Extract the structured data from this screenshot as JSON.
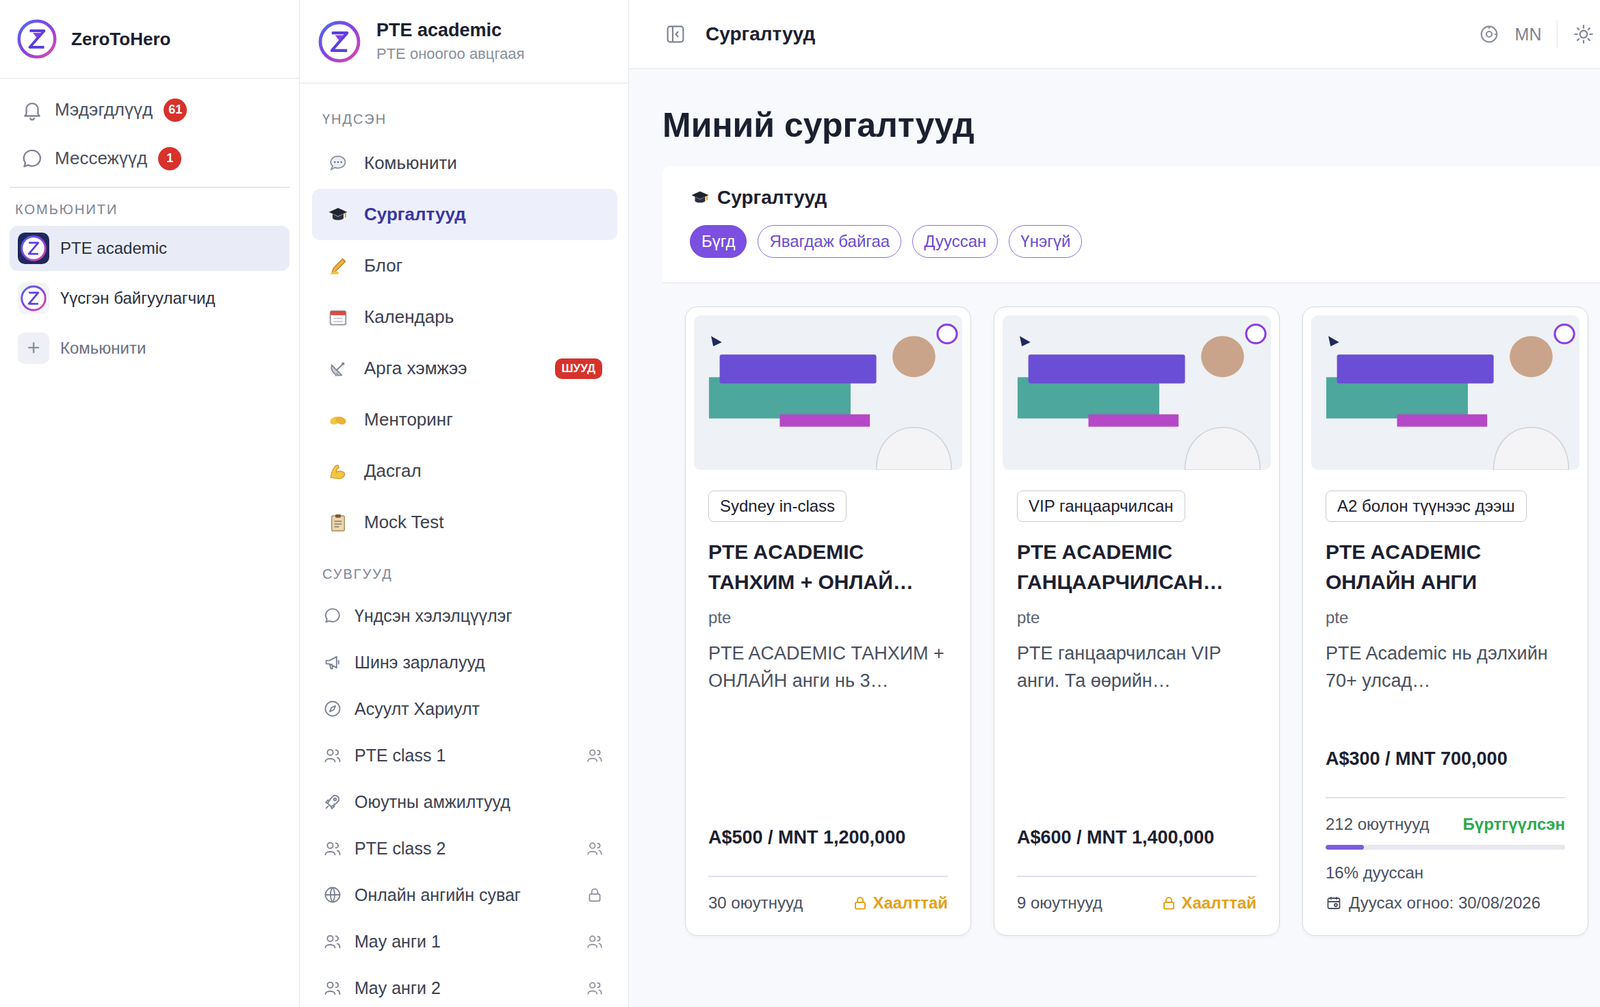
{
  "app": {
    "name": "ZeroToHero"
  },
  "nav": [
    {
      "label": "Мэдэгдлүүд",
      "badge": "61",
      "kind": "notifications"
    },
    {
      "label": "Мессежүүд",
      "badge": "1",
      "kind": "messages"
    }
  ],
  "communities": {
    "heading": "КОМЬЮНИТИ",
    "items": [
      {
        "label": "PTE academic",
        "selected": true
      },
      {
        "label": "Үүсгэн байгуулагчид",
        "selected": false
      }
    ],
    "add": {
      "icon": "+",
      "label": "Комьюнити"
    }
  },
  "community": {
    "name": "PTE academic",
    "subtitle": "PTE оноогоо авцгаая"
  },
  "menu": {
    "heading": "ҮНДСЭН",
    "items": [
      {
        "kind": "community",
        "label": "Комьюнити",
        "selected": false,
        "badge": ""
      },
      {
        "kind": "courses",
        "label": "Сургалтууд",
        "selected": true,
        "badge": ""
      },
      {
        "kind": "blog",
        "label": "Блог",
        "selected": false,
        "badge": ""
      },
      {
        "kind": "calendar",
        "label": "Календарь",
        "selected": false,
        "badge": ""
      },
      {
        "kind": "events",
        "label": "Арга хэмжээ",
        "selected": false,
        "badge": "ШУУД"
      },
      {
        "kind": "mentoring",
        "label": "Менторинг",
        "selected": false,
        "badge": ""
      },
      {
        "kind": "exercise",
        "label": "Дасгал",
        "selected": false,
        "badge": ""
      },
      {
        "kind": "mock-test",
        "label": "Mock Test",
        "selected": false,
        "badge": ""
      }
    ]
  },
  "channels": {
    "heading": "СУВГУУД",
    "items": [
      {
        "kind": "discussion",
        "label": "Үндсэн хэлэлцүүлэг",
        "locked": false
      },
      {
        "kind": "announcement",
        "label": "Шинэ зарлалууд",
        "locked": false
      },
      {
        "kind": "qa",
        "label": "Асуулт Хариулт",
        "locked": false
      },
      {
        "kind": "group",
        "label": "PTE class 1",
        "locked": false
      },
      {
        "kind": "showcase",
        "label": "Оюутны амжилтууд",
        "locked": false
      },
      {
        "kind": "group",
        "label": "PTE class 2",
        "locked": false
      },
      {
        "kind": "public",
        "label": "Онлайн ангийн суваг",
        "locked": true
      },
      {
        "kind": "group",
        "label": "May анги 1",
        "locked": false
      },
      {
        "kind": "group",
        "label": "May анги 2",
        "locked": false
      }
    ]
  },
  "topbar": {
    "title": "Сургалтууд",
    "language": "MN"
  },
  "page": {
    "title": "Миний сургалтууд"
  },
  "panel": {
    "title": "Сургалтууд",
    "filters": [
      {
        "label": "Бүгд",
        "selected": true
      },
      {
        "label": "Явагдаж байгаа",
        "selected": false
      },
      {
        "label": "Дууссан",
        "selected": false
      },
      {
        "label": "Үнэгүй",
        "selected": false
      }
    ]
  },
  "courses": [
    {
      "kind": "locked",
      "tag": "Sydney in-class",
      "title": "PTE ACADEMIC ТАНХИМ + ОНЛАЙ…",
      "category": "pte",
      "description": "PTE ACADEMIC ТАНХИМ + ОНЛАЙН анги нь 3…",
      "price": "A$500 / MNT 1,200,000",
      "students": "30 оюутнууд",
      "status": "Хаалттай",
      "color": "#e3a21a"
    },
    {
      "kind": "locked",
      "tag": "VIP ганцаарчилсан",
      "title": "PTE ACADEMIC ГАНЦААРЧИЛСАН…",
      "category": "pte",
      "description": "PTE ганцаарчилсан VIP анги. Та өөрийн…",
      "price": "A$600 / MNT 1,400,000",
      "students": "9 оюутнууд",
      "status": "Хаалттай",
      "color": "#e3a21a"
    },
    {
      "kind": "enrolled",
      "tag": "A2 болон түүнээс дээш",
      "title": "PTE ACADEMIC ОНЛАЙН АНГИ",
      "category": "pte",
      "description": "PTE Academic нь дэлхийн 70+ улсад…",
      "price": "A$300 / MNT 700,000",
      "students": "212 оюутнууд",
      "status": "Бүртгүүлсэн",
      "color": "#2fa84f",
      "level": 0.16,
      "progress": "16% дууссан",
      "deadline": "Дуусах огноо: 30/08/2026"
    }
  ]
}
